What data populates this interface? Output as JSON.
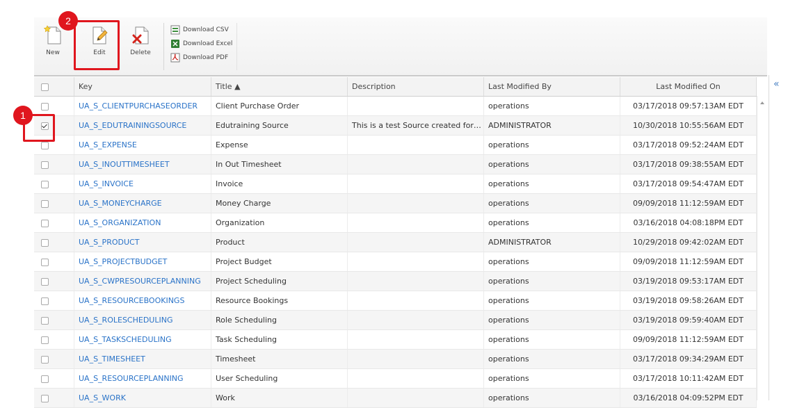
{
  "toolbar": {
    "new_label": "New",
    "edit_label": "Edit",
    "delete_label": "Delete",
    "download_csv": "Download CSV",
    "download_excel": "Download Excel",
    "download_pdf": "Download PDF"
  },
  "table": {
    "headers": {
      "key": "Key",
      "title": "Title ▲",
      "description": "Description",
      "modified_by": "Last Modified By",
      "modified_on": "Last Modified On"
    },
    "rows": [
      {
        "key": "UA_S_CLIENTPURCHASEORDER",
        "title": "Client Purchase Order",
        "description": "",
        "modified_by": "operations",
        "modified_on": "03/17/2018 09:57:13AM EDT",
        "checked": false
      },
      {
        "key": "UA_S_EDUTRAININGSOURCE",
        "title": "Edutraining Source",
        "description": "This is a test Source created for th...",
        "modified_by": "ADMINISTRATOR",
        "modified_on": "10/30/2018 10:55:56AM EDT",
        "checked": true
      },
      {
        "key": "UA_S_EXPENSE",
        "title": "Expense",
        "description": "",
        "modified_by": "operations",
        "modified_on": "03/17/2018 09:52:24AM EDT",
        "checked": false
      },
      {
        "key": "UA_S_INOUTTIMESHEET",
        "title": "In Out Timesheet",
        "description": "",
        "modified_by": "operations",
        "modified_on": "03/17/2018 09:38:55AM EDT",
        "checked": false
      },
      {
        "key": "UA_S_INVOICE",
        "title": "Invoice",
        "description": "",
        "modified_by": "operations",
        "modified_on": "03/17/2018 09:54:47AM EDT",
        "checked": false
      },
      {
        "key": "UA_S_MONEYCHARGE",
        "title": "Money Charge",
        "description": "",
        "modified_by": "operations",
        "modified_on": "09/09/2018 11:12:59AM EDT",
        "checked": false
      },
      {
        "key": "UA_S_ORGANIZATION",
        "title": "Organization",
        "description": "",
        "modified_by": "operations",
        "modified_on": "03/16/2018 04:08:18PM EDT",
        "checked": false
      },
      {
        "key": "UA_S_PRODUCT",
        "title": "Product",
        "description": "",
        "modified_by": "ADMINISTRATOR",
        "modified_on": "10/29/2018 09:42:02AM EDT",
        "checked": false
      },
      {
        "key": "UA_S_PROJECTBUDGET",
        "title": "Project Budget",
        "description": "",
        "modified_by": "operations",
        "modified_on": "09/09/2018 11:12:59AM EDT",
        "checked": false
      },
      {
        "key": "UA_S_CWPRESOURCEPLANNING",
        "title": "Project Scheduling",
        "description": "",
        "modified_by": "operations",
        "modified_on": "03/19/2018 09:53:17AM EDT",
        "checked": false
      },
      {
        "key": "UA_S_RESOURCEBOOKINGS",
        "title": "Resource Bookings",
        "description": "",
        "modified_by": "operations",
        "modified_on": "03/19/2018 09:58:26AM EDT",
        "checked": false
      },
      {
        "key": "UA_S_ROLESCHEDULING",
        "title": "Role Scheduling",
        "description": "",
        "modified_by": "operations",
        "modified_on": "03/19/2018 09:59:40AM EDT",
        "checked": false
      },
      {
        "key": "UA_S_TASKSCHEDULING",
        "title": "Task Scheduling",
        "description": "",
        "modified_by": "operations",
        "modified_on": "09/09/2018 11:12:59AM EDT",
        "checked": false
      },
      {
        "key": "UA_S_TIMESHEET",
        "title": "Timesheet",
        "description": "",
        "modified_by": "operations",
        "modified_on": "03/17/2018 09:34:29AM EDT",
        "checked": false
      },
      {
        "key": "UA_S_RESOURCEPLANNING",
        "title": "User Scheduling",
        "description": "",
        "modified_by": "operations",
        "modified_on": "03/17/2018 10:11:42AM EDT",
        "checked": false
      },
      {
        "key": "UA_S_WORK",
        "title": "Work",
        "description": "",
        "modified_by": "operations",
        "modified_on": "03/16/2018 04:09:52PM EDT",
        "checked": false
      }
    ]
  },
  "annotations": {
    "step1": "1",
    "step2": "2"
  },
  "right_panel": {
    "collapse_glyph": "«"
  },
  "colors": {
    "highlight": "#e0161e",
    "link": "#2a73c8"
  }
}
